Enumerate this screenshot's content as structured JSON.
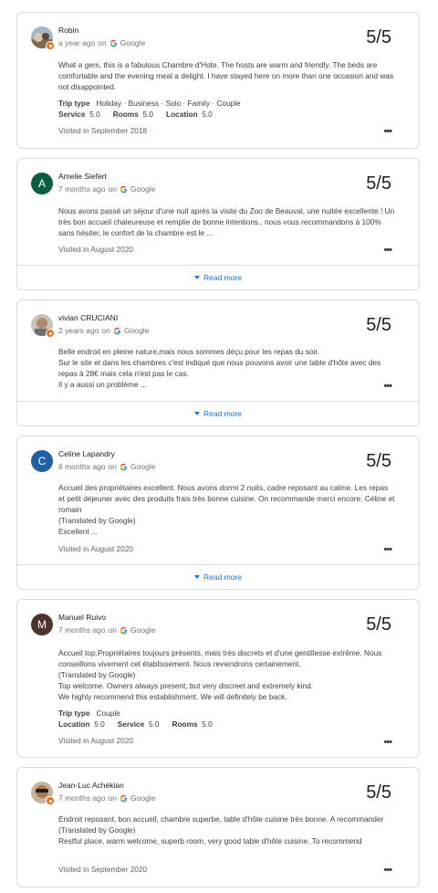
{
  "colors": {
    "link": "#1a73e8",
    "border": "#dadce0",
    "local_guide_badge": "#e8711a",
    "avatar_amelie": "#0b5f3e",
    "avatar_celine": "#1f5fa6",
    "avatar_manuel": "#4e342e"
  },
  "source": {
    "on": "on",
    "name": "Google",
    "icon": "google-g-icon"
  },
  "read_more_label": "Read more",
  "more_icon": "more-horizontal-icon",
  "reviews": [
    {
      "name": "Robin",
      "avatar_type": "photo",
      "time": "a year ago",
      "rating": "5/5",
      "text": [
        "What a gem, this is a fabulous Chambre d'Hote. The hosts are warm and friendly. The beds are comfortable and the evening meal a delight. I have stayed here on more than one occasion and was not disappointed."
      ],
      "trip_type_label": "Trip type",
      "trip_type": "Holiday · Business · Solo · Family · Couple",
      "ratings": [
        {
          "label": "Service",
          "value": "5.0"
        },
        {
          "label": "Rooms",
          "value": "5.0"
        },
        {
          "label": "Location",
          "value": "5.0"
        }
      ],
      "visited": "Visited in September 2018"
    },
    {
      "name": "Amelie Siefert",
      "avatar_type": "letter",
      "avatar_letter": "A",
      "time": "7 months ago",
      "rating": "5/5",
      "text": [
        "Nous avons passé un séjour d'une nuit après la visite du Zoo de Beauval, une nuitée excellente ! Un très bon accueil chaleureuse et remplie de bonne intentions.. nous vous recommandons à 100% sans hésiter, le confort de la chambre est le ..."
      ],
      "visited": "Visited in August 2020"
    },
    {
      "name": "vivian CRUCIANI",
      "avatar_type": "photo",
      "time": "2 years ago",
      "rating": "5/5",
      "text": [
        "Belle endroit en pleine nature,mais nous sommes déçu pour les repas du soir.",
        "Sur le site et dans les chambres c'est indiqué que nous pouvons avoir une table d'hôte avec des repas à 28€ mais cela n'est pas le cas.",
        "Il y a aussi un problème ..."
      ]
    },
    {
      "name": "Celine Lapandry",
      "avatar_type": "letter",
      "avatar_letter": "C",
      "time": "8 months ago",
      "rating": "5/5",
      "text": [
        "Accueil des propriétaires excellent. Nous avons dormi 2 nuits, cadre reposant au calme. Les repas et petit déjeuner avec des produits frais très bonne cuisine. On recommande merci encore. Céline et romain",
        "(Translated by Google)",
        "Excellent ..."
      ],
      "visited": "Visited in August 2020"
    },
    {
      "name": "Manuel Ruivo",
      "avatar_type": "letter",
      "avatar_letter": "M",
      "time": "7 months ago",
      "rating": "5/5",
      "text": [
        "Accueil top.Propriétaires toujours présents, mais très discrets et d'une gentillesse extrême. Nous conseillons vivement cet établissement. Nous reviendrons certainement.",
        "(Translated by Google)",
        "Top welcome. Owners always present, but very discreet and extremely kind.",
        "We highly recommend this establishment. We will definitely be back."
      ],
      "trip_type_label": "Trip type",
      "trip_type": "Couple",
      "ratings": [
        {
          "label": "Location",
          "value": "5.0"
        },
        {
          "label": "Service",
          "value": "5.0"
        },
        {
          "label": "Rooms",
          "value": "5.0"
        }
      ],
      "visited": "Visited in August 2020"
    },
    {
      "name": "Jean-Luc Achékian",
      "avatar_type": "photo",
      "time": "7 months ago",
      "rating": "5/5",
      "text": [
        "Endroit reposant, bon accueil, chambre superbe, table d'hôte cuisine très bonne. A recommander",
        "(Translated by Google)",
        "Restful place, warm welcome, superb room, very good table d'hôte cuisine. To recommend"
      ],
      "visited": "Visited in September 2020"
    }
  ]
}
